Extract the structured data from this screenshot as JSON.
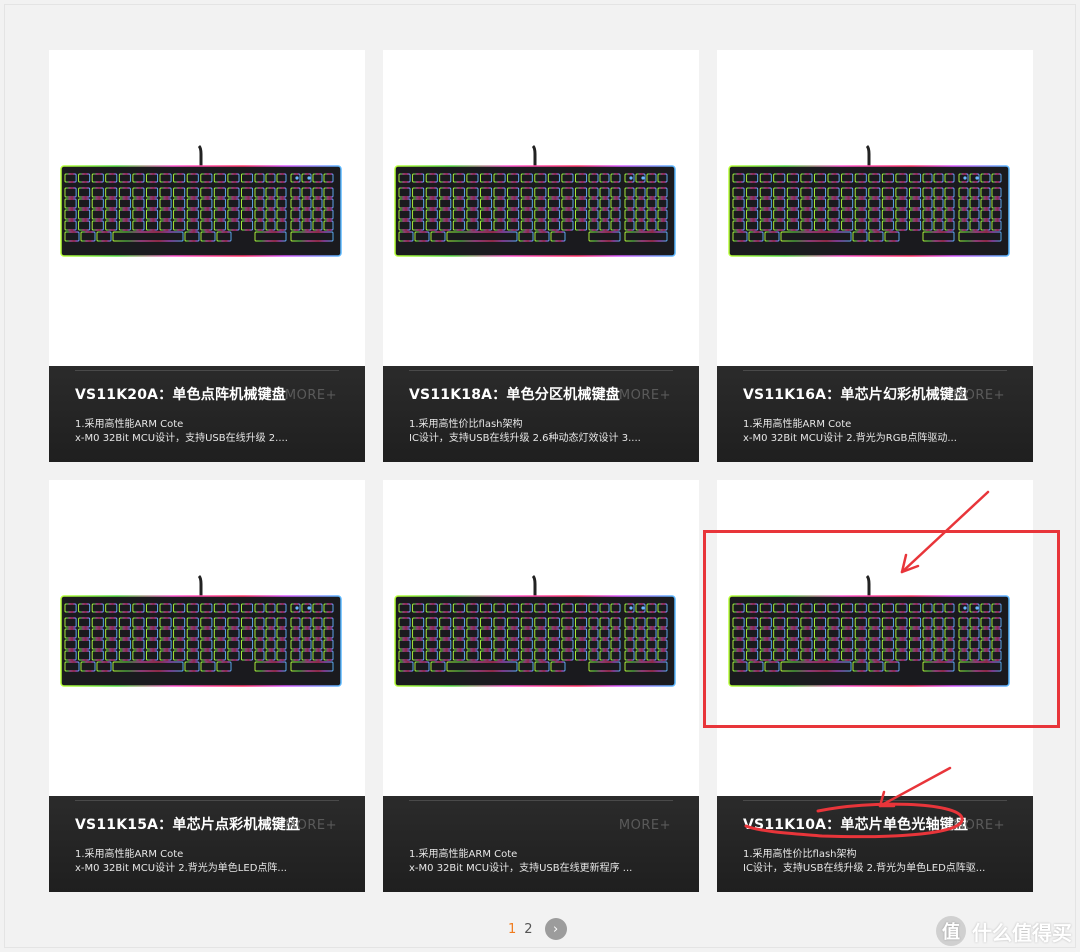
{
  "products": [
    {
      "title": "VS11K20A：单色点阵机械键盘",
      "more": "MORE+",
      "desc_line1": "1.采用高性能ARM Cote",
      "desc_line2": "x-M0 32Bit MCU设计，支持USB在线升级 2...."
    },
    {
      "title": "VS11K18A：单色分区机械键盘",
      "more": "MORE+",
      "desc_line1": "1.采用高性价比flash架构",
      "desc_line2": "IC设计，支持USB在线升级 2.6种动态灯效设计 3...."
    },
    {
      "title": "VS11K16A：单芯片幻彩机械键盘",
      "more": "MORE+",
      "desc_line1": "1.采用高性能ARM Cote",
      "desc_line2": "x-M0 32Bit MCU设计 2.背光为RGB点阵驱动..."
    },
    {
      "title": "VS11K15A：单芯片点彩机械键盘",
      "more": "MORE+",
      "desc_line1": "1.采用高性能ARM Cote",
      "desc_line2": "x-M0 32Bit MCU设计 2.背光为单色LED点阵..."
    },
    {
      "title": "",
      "more": "MORE+",
      "desc_line1": "1.采用高性能ARM Cote",
      "desc_line2": "x-M0 32Bit MCU设计，支持USB在线更新程序 ..."
    },
    {
      "title": "VS11K10A：单芯片单色光轴键盘",
      "more": "MORE+",
      "desc_line1": "1.采用高性价比flash架构",
      "desc_line2": "IC设计，支持USB在线升级 2.背光为单色LED点阵驱..."
    }
  ],
  "pagination": {
    "pages": [
      "1",
      "2"
    ],
    "current": "1",
    "next_icon": "chevron-right-icon",
    "next_glyph": "›"
  },
  "watermark": {
    "text": "什么值得买",
    "glyph": "值"
  },
  "colors": {
    "annotation": "#e8353a",
    "page_active": "#f07c1e",
    "card_footer": "#222222"
  }
}
